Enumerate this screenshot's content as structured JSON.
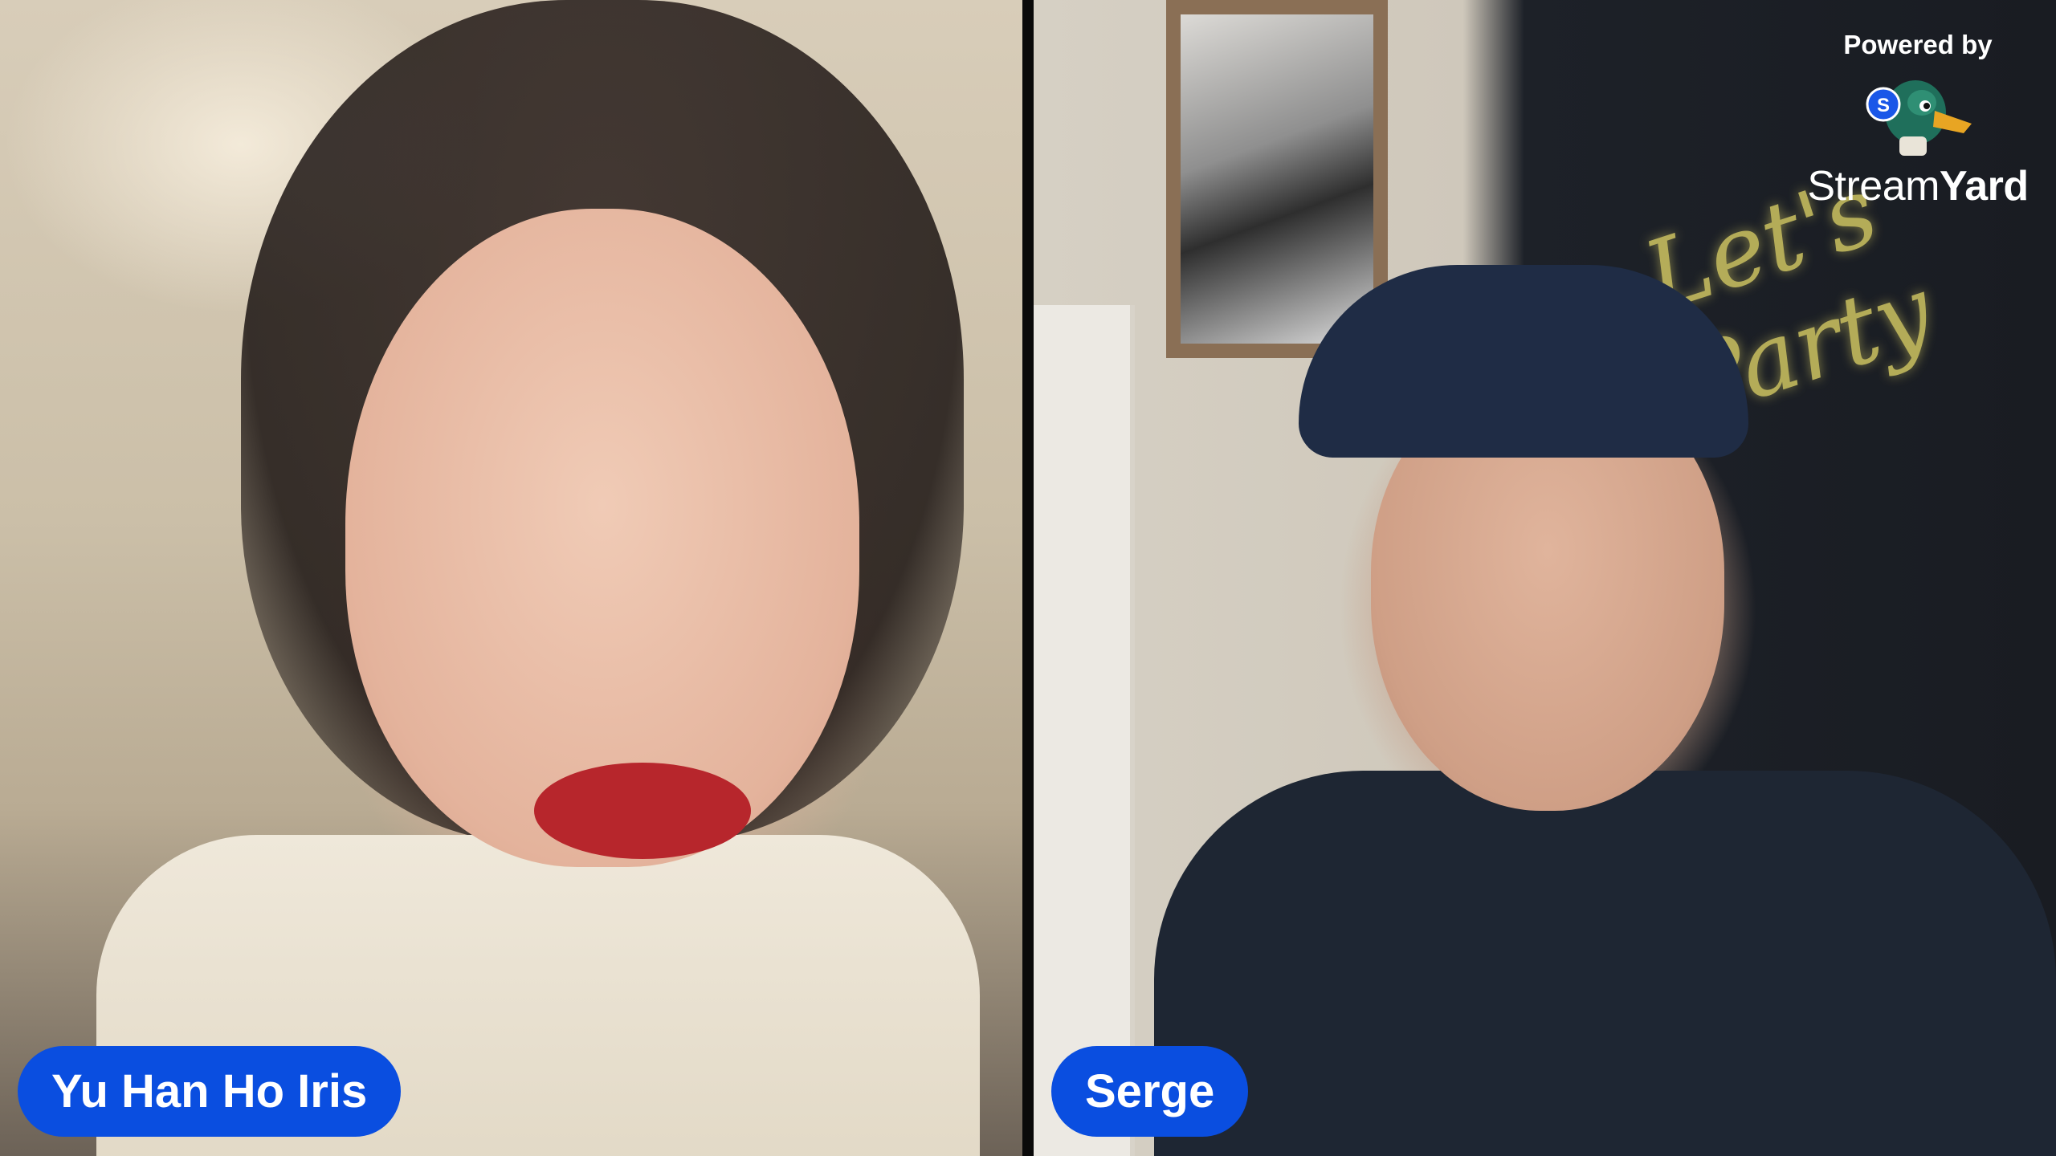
{
  "participants": [
    {
      "name": "Yu Han Ho Iris"
    },
    {
      "name": "Serge"
    }
  ],
  "branding": {
    "powered_by": "Powered by",
    "wordmark_light": "Stream",
    "wordmark_bold": "Yard",
    "logo_icon": "streamyard-duck-icon",
    "logo_badge_letter": "S"
  },
  "scene": {
    "neon_sign_text": "Let's Party"
  },
  "colors": {
    "name_tag_bg": "#0a4ee0",
    "name_tag_text": "#ffffff",
    "divider": "#0a0a0a"
  }
}
